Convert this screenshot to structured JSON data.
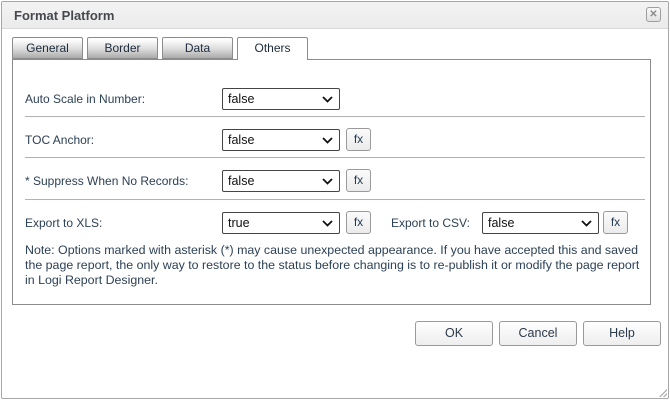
{
  "dialog": {
    "title": "Format Platform",
    "close_glyph": "✕"
  },
  "tabs": [
    {
      "label": "General",
      "active": false
    },
    {
      "label": "Border",
      "active": false
    },
    {
      "label": "Data",
      "active": false
    },
    {
      "label": "Others",
      "active": true
    }
  ],
  "fields": {
    "auto_scale": {
      "label": "Auto Scale in Number:",
      "value": "false",
      "has_fx": false
    },
    "toc_anchor": {
      "label": "TOC Anchor:",
      "value": "false",
      "has_fx": true
    },
    "suppress_no_records": {
      "label": "* Suppress When No Records:",
      "value": "false",
      "has_fx": true
    },
    "export_xls": {
      "label": "Export to XLS:",
      "value": "true",
      "has_fx": true
    },
    "export_csv": {
      "label": "Export to CSV:",
      "value": "false",
      "has_fx": true
    }
  },
  "fx_button_label": "fx",
  "note": "Note: Options marked with asterisk (*) may cause unexpected appearance. If you have accepted this and saved the page report, the only way to restore to the status before changing is to re-publish it or modify the page report in Logi Report Designer.",
  "buttons": {
    "ok": "OK",
    "cancel": "Cancel",
    "help": "Help"
  },
  "colors": {
    "label_text": "#2d4156",
    "title_text": "#45494f",
    "panel_border": "#8c8c8c",
    "select_border": "#454545",
    "tab_gradient_bottom": "#ababab"
  }
}
